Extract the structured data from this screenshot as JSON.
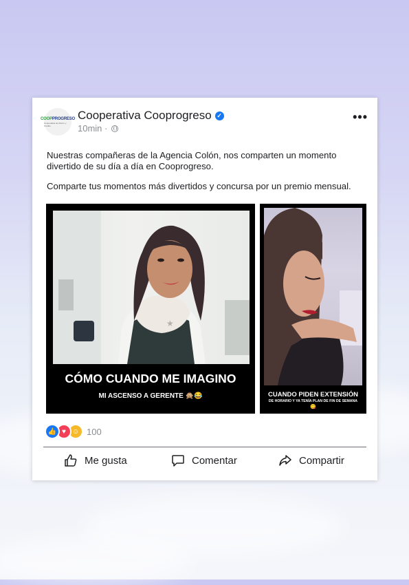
{
  "post": {
    "author": "Cooperativa Cooprogreso",
    "time": "10min",
    "separator": "·",
    "logo": {
      "part_green": "COOP",
      "part_blue": "PROGRESO",
      "tagline": "Cooperativa de Ahorro y Crédito"
    },
    "body": [
      "Nuestras compañeras de la Agencia Colón, nos comparten un momento divertido de su día a día en Cooprogreso.",
      "Comparte tus momentos más divertidos y concursa por un premio mensual."
    ],
    "media": {
      "left": {
        "headline": "CÓMO CUANDO ME IMAGINO",
        "subline": "MI ASCENSO A GERENTE 🙊😂"
      },
      "right": {
        "headline": "CUANDO PIDEN EXTENSIÓN",
        "subline": "DE HORARIO Y YA TENÍA PLAN DE FIN DE SEMANA",
        "emoji": "😋"
      }
    },
    "reactions": {
      "icons": [
        "like-icon",
        "love-icon",
        "care-icon"
      ],
      "count": "100"
    },
    "actions": {
      "like": "Me gusta",
      "comment": "Comentar",
      "share": "Compartir"
    }
  },
  "colors": {
    "accent": "#1877f2",
    "love": "#f33e58",
    "care": "#f7b928",
    "logo_green": "#2a9a3b",
    "logo_blue": "#1f3e8f"
  }
}
